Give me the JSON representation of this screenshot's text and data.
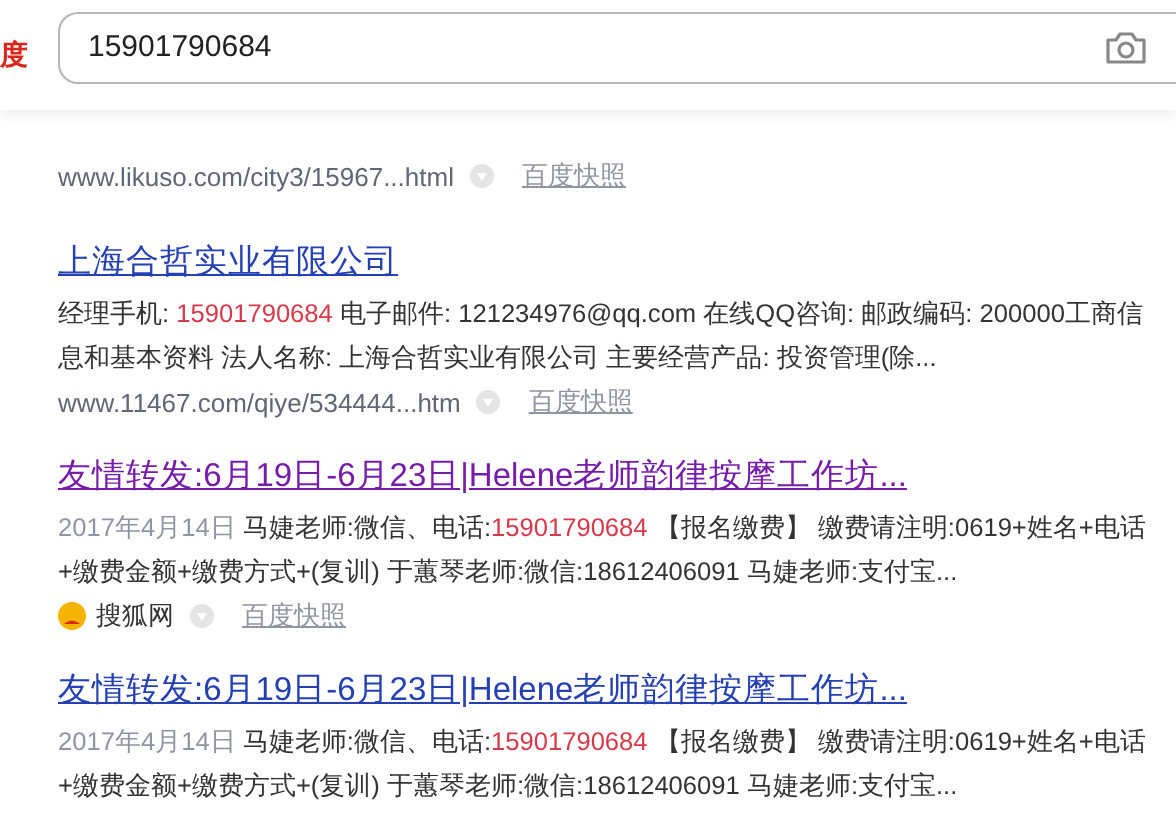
{
  "header": {
    "logo": "度",
    "search": {
      "value": "15901790684"
    }
  },
  "results": [
    {
      "url": "www.likuso.com/city3/15967...html",
      "snapshot": "百度快照"
    },
    {
      "title": "上海合哲实业有限公司",
      "visited": false,
      "snippet": [
        {
          "kind": "plain",
          "text": "经理手机: "
        },
        {
          "kind": "match",
          "text": "15901790684"
        },
        {
          "kind": "plain",
          "text": " 电子邮件: 121234976@qq.com 在线QQ咨询: 邮政编码: 200000工商信息和基本资料 法人名称: 上海合哲实业有限公司 主要经营产品: 投资管理(除..."
        }
      ],
      "url": "www.11467.com/qiye/534444...htm",
      "snapshot": "百度快照"
    },
    {
      "title": "友情转发:6月19日-6月23日|Helene老师韵律按摩工作坊...",
      "visited": true,
      "snippet": [
        {
          "kind": "date",
          "text": "2017年4月14日"
        },
        {
          "kind": "plain",
          "text": " 马婕老师:微信、电话:"
        },
        {
          "kind": "match",
          "text": "15901790684"
        },
        {
          "kind": "plain",
          "text": " 【报名缴费】 缴费请注明:0619+姓名+电话+缴费金额+缴费方式+(复训) 于蕙琴老师:微信:18612406091 马婕老师:支付宝..."
        }
      ],
      "source": "搜狐网",
      "snapshot": "百度快照"
    },
    {
      "title": "友情转发:6月19日-6月23日|Helene老师韵律按摩工作坊...",
      "visited": false,
      "snippet": [
        {
          "kind": "date",
          "text": "2017年4月14日"
        },
        {
          "kind": "plain",
          "text": " 马婕老师:微信、电话:"
        },
        {
          "kind": "match",
          "text": "15901790684"
        },
        {
          "kind": "plain",
          "text": " 【报名缴费】 缴费请注明:0619+姓名+电话+缴费金额+缴费方式+(复训) 于蕙琴老师:微信:18612406091 马婕老师:支付宝..."
        }
      ]
    }
  ]
}
